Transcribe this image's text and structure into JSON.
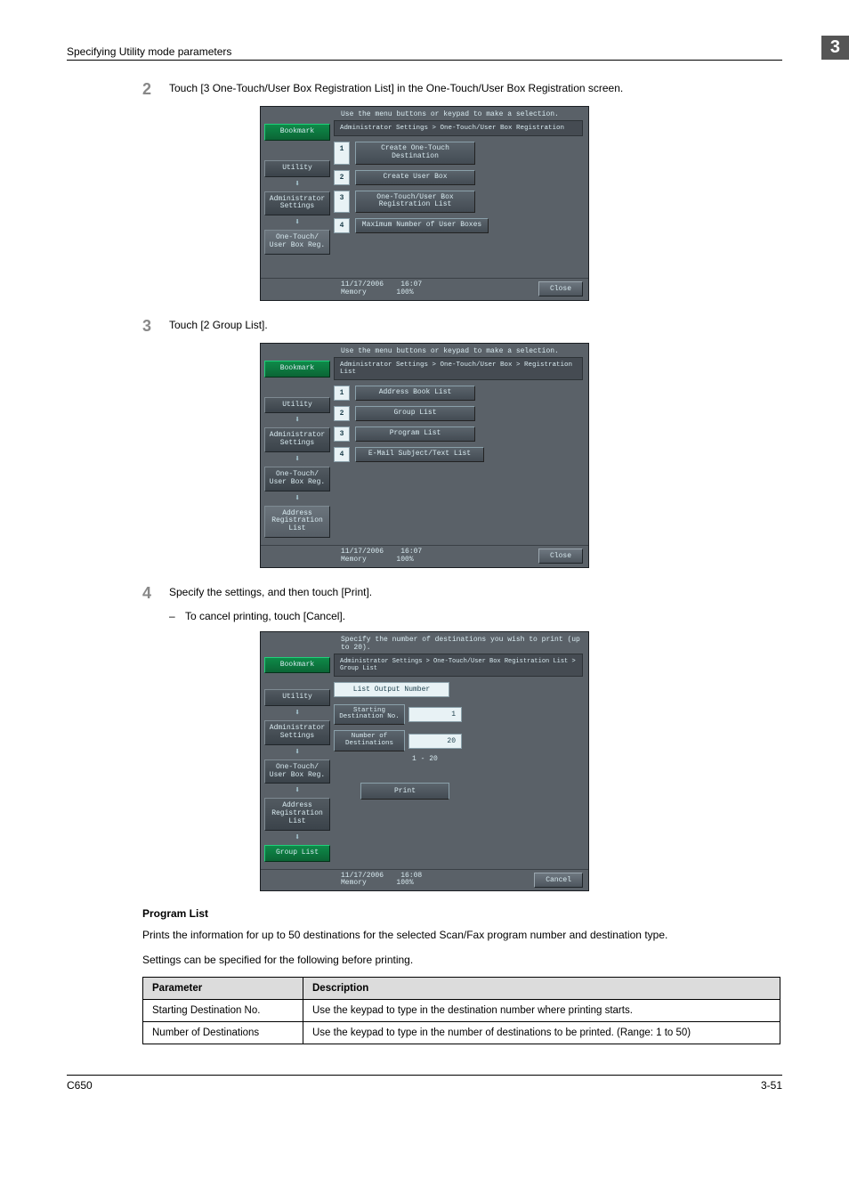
{
  "header": {
    "section_title": "Specifying Utility mode parameters",
    "chapter_no": "3"
  },
  "steps": {
    "s2": {
      "num": "2",
      "text": "Touch [3 One-Touch/User Box Registration List] in the One-Touch/User Box Registration screen."
    },
    "s3": {
      "num": "3",
      "text": "Touch [2 Group List]."
    },
    "s4": {
      "num": "4",
      "text": "Specify the settings, and then touch [Print].",
      "sub": "To cancel printing, touch [Cancel]."
    }
  },
  "panel_a": {
    "instruction": "Use the menu buttons or keypad to make a selection.",
    "breadcrumb": "Administrator Settings > One-Touch/User Box Registration",
    "left": {
      "bookmark": "Bookmark",
      "b1": "Utility",
      "b2": "Administrator\nSettings",
      "b3": "One-Touch/\nUser Box Reg."
    },
    "menu": [
      {
        "n": "1",
        "label": "Create One-Touch\nDestination"
      },
      {
        "n": "2",
        "label": "Create User Box"
      },
      {
        "n": "3",
        "label": "One-Touch/User Box\nRegistration List"
      },
      {
        "n": "4",
        "label": "Maximum Number of User Boxes"
      }
    ],
    "foot": {
      "date": "11/17/2006",
      "time": "16:07",
      "mem_label": "Memory",
      "mem_val": "100%",
      "close": "Close"
    }
  },
  "panel_b": {
    "instruction": "Use the menu buttons or keypad to make a selection.",
    "breadcrumb": "Administrator Settings > One-Touch/User Box > Registration List",
    "left": {
      "bookmark": "Bookmark",
      "b1": "Utility",
      "b2": "Administrator\nSettings",
      "b3": "One-Touch/\nUser Box Reg.",
      "b4": "Address\nRegistration\nList"
    },
    "menu": [
      {
        "n": "1",
        "label": "Address Book List"
      },
      {
        "n": "2",
        "label": "Group List"
      },
      {
        "n": "3",
        "label": "Program List"
      },
      {
        "n": "4",
        "label": "E-Mail Subject/Text List"
      }
    ],
    "foot": {
      "date": "11/17/2006",
      "time": "16:07",
      "mem_label": "Memory",
      "mem_val": "100%",
      "close": "Close"
    }
  },
  "panel_c": {
    "instruction": "Specify the number of destinations you wish to print (up to 20).",
    "breadcrumb": "Administrator Settings > One-Touch/User Box Registration List > Group List",
    "subheader": "List Output Number",
    "left": {
      "bookmark": "Bookmark",
      "b1": "Utility",
      "b2": "Administrator\nSettings",
      "b3": "One-Touch/\nUser Box Reg.",
      "b4": "Address\nRegistration\nList",
      "b5": "Group List"
    },
    "fields": {
      "start_label": "Starting\nDestination No.",
      "start_val": "1",
      "num_label": "Number of\nDestinations",
      "num_val": "20",
      "range": "1  -  20"
    },
    "print": "Print",
    "foot": {
      "date": "11/17/2006",
      "time": "16:08",
      "mem_label": "Memory",
      "mem_val": "100%",
      "cancel": "Cancel"
    }
  },
  "program_list": {
    "heading": "Program List",
    "p1": "Prints the information for up to 50 destinations for the selected Scan/Fax program number and destination type.",
    "p2": "Settings can be specified for the following before printing."
  },
  "table": {
    "h1": "Parameter",
    "h2": "Description",
    "rows": [
      {
        "p": "Starting Destination No.",
        "d": "Use the keypad to type in the destination number where printing starts."
      },
      {
        "p": "Number of Destinations",
        "d": "Use the keypad to type in the number of destinations to be printed. (Range: 1 to 50)"
      }
    ]
  },
  "footer": {
    "model": "C650",
    "page": "3-51"
  }
}
